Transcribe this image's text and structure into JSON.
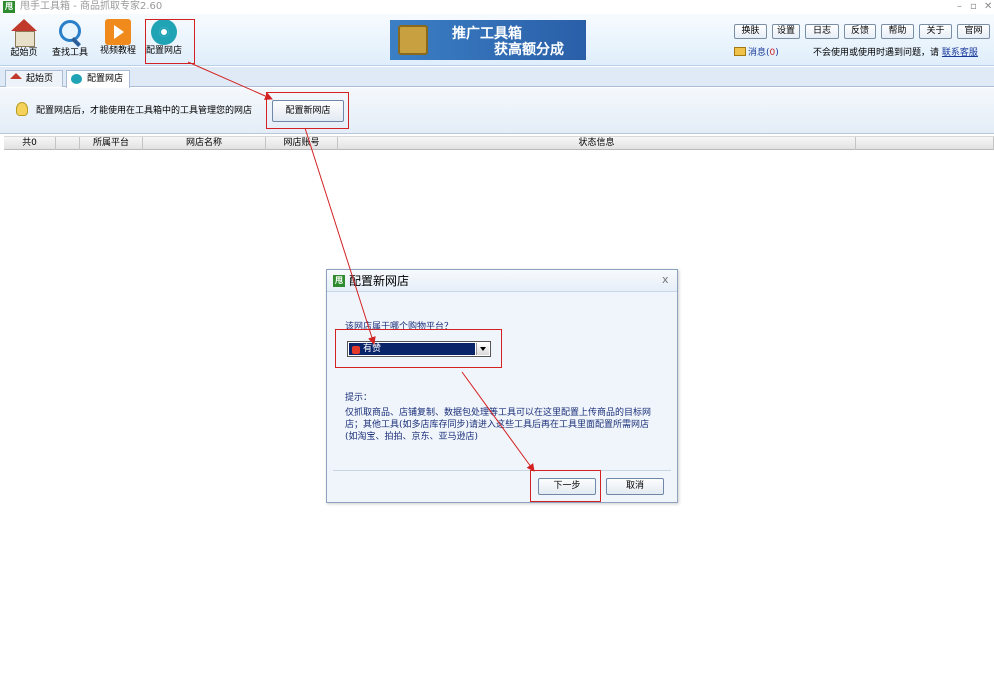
{
  "window": {
    "logo_text": "甩",
    "title": "甩手工具箱 - 商品抓取专家2.60",
    "minimize": "–",
    "maximize": "▫",
    "close": "✕"
  },
  "toolbar": {
    "items": [
      {
        "label": "起始页",
        "icon": "home-icon"
      },
      {
        "label": "查找工具",
        "icon": "search-icon"
      },
      {
        "label": "视频教程",
        "icon": "video-icon"
      },
      {
        "label": "配置网店",
        "icon": "gear-icon"
      }
    ],
    "banner": {
      "line1": "推广工具箱",
      "line2": "获高额分成"
    },
    "buttons": [
      "换肤",
      "设置",
      "日志",
      "反馈",
      "帮助",
      "关于",
      "官网"
    ],
    "message": {
      "label": "消息(",
      "count": "0",
      "suffix": ")"
    },
    "help": {
      "text": "不会使用或使用时遇到问题，请",
      "link": "联系客服"
    }
  },
  "tabs": [
    {
      "label": "起始页",
      "icon": "home-icon"
    },
    {
      "label": "配置网店",
      "icon": "gear-icon"
    }
  ],
  "config": {
    "hint": "配置网店后，才能使用在工具箱中的工具管理您的网店",
    "button": "配置新网店"
  },
  "table": {
    "columns": [
      "共0",
      "",
      "所属平台",
      "网店名称",
      "网店账号",
      "状态信息",
      ""
    ]
  },
  "dialog": {
    "logo_text": "甩",
    "title": "配置新网店",
    "close": "x",
    "question": "该网店属于哪个购物平台？",
    "selected_platform": "有赞",
    "tip_title": "提示：",
    "tip_body": "仅抓取商品、店铺复制、数据包处理等工具可以在这里配置上传商品的目标网店；其他工具(如多店库存同步)请进入这些工具后再在工具里面配置所需网店(如淘宝、拍拍、京东、亚马逊店)",
    "next": "下一步",
    "cancel": "取消"
  },
  "colors": {
    "annotation": "#d32222",
    "selection": "#0a246a",
    "toolbar_top": "#f7fbff",
    "toolbar_bottom": "#dfeefb"
  }
}
